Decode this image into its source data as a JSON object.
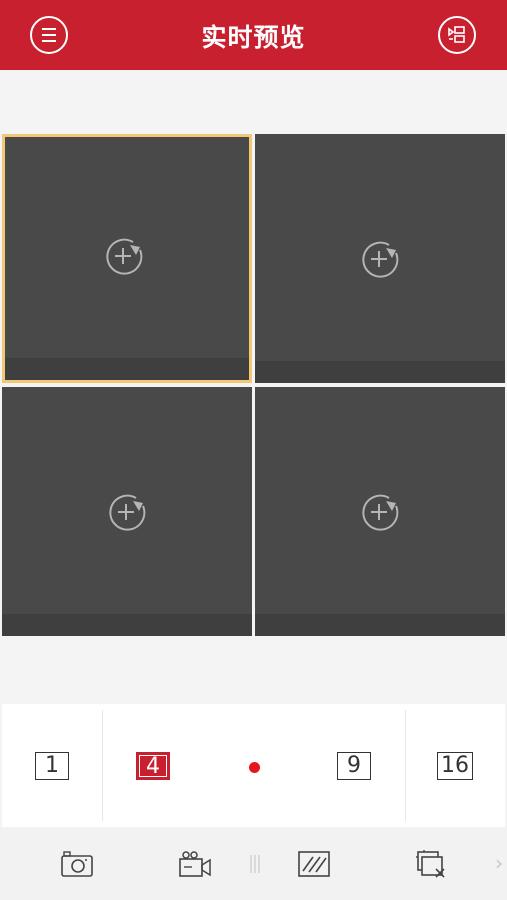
{
  "header": {
    "title": "实时预览",
    "menu_icon": "menu-icon",
    "list_icon": "device-list-icon",
    "background": "#c8202f"
  },
  "grid": {
    "selected_index": 0,
    "selected_border": "#f0c878",
    "cells": [
      {
        "icon": "add-camera-icon"
      },
      {
        "icon": "add-camera-icon"
      },
      {
        "icon": "add-camera-icon"
      },
      {
        "icon": "add-camera-icon"
      }
    ]
  },
  "layouts": {
    "options": [
      "1",
      "4",
      "9",
      "16"
    ],
    "active": "4",
    "page_indicator_color": "#e8141c"
  },
  "toolbar": {
    "icons": [
      "camera-icon",
      "video-record-icon",
      "image-quality-icon",
      "close-all-icon"
    ],
    "more_arrow": "›"
  }
}
